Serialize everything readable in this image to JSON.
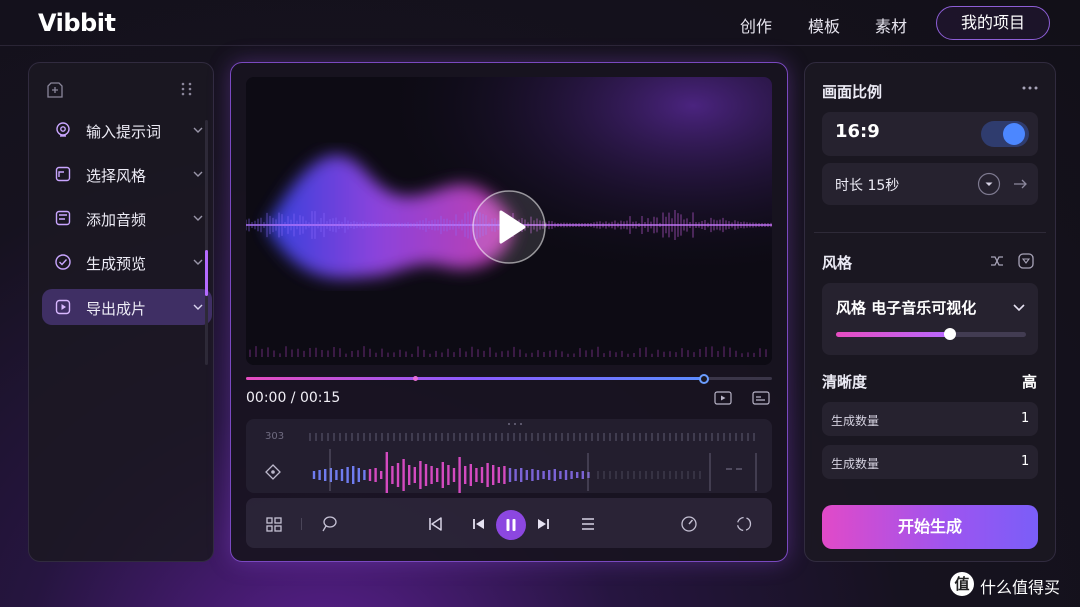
{
  "app": {
    "name": "Vibbit"
  },
  "nav": {
    "items": [
      {
        "label": "创作"
      },
      {
        "label": "模板"
      },
      {
        "label": "素材"
      }
    ],
    "my_projects": "我的项目"
  },
  "sidebar": {
    "items": [
      {
        "label": "输入提示词",
        "icon": "lightbulb-icon"
      },
      {
        "label": "选择风格",
        "icon": "style-card-icon"
      },
      {
        "label": "添加音频",
        "icon": "audio-file-icon"
      },
      {
        "label": "生成预览",
        "icon": "check-badge-icon"
      },
      {
        "label": "导出成片",
        "icon": "export-play-icon",
        "active": true
      }
    ]
  },
  "player": {
    "current_time": "00:00",
    "separator": " / ",
    "duration": "00:15",
    "progress": 0.87,
    "marker": 0.34
  },
  "timeline": {
    "label": "303"
  },
  "settings": {
    "aspect": {
      "title": "画面比例",
      "value": "16:9",
      "toggle_on": true
    },
    "duration": {
      "label": "时长 15秒"
    },
    "style": {
      "title": "风格",
      "value": "风格 电子音乐可视化",
      "slider": 0.6
    },
    "quality": {
      "title": "清晰度",
      "value": "高"
    },
    "rows": [
      {
        "label": "生成数量",
        "value": "1"
      },
      {
        "label": "生成数量",
        "value": "1"
      }
    ],
    "generate": "开始生成"
  },
  "watermark": {
    "logo": "值",
    "text": "什么值得买"
  },
  "colors": {
    "accent": "#8c47e0",
    "pink": "#e64cc0",
    "blue": "#4c87ff",
    "bg": "#16121f"
  }
}
